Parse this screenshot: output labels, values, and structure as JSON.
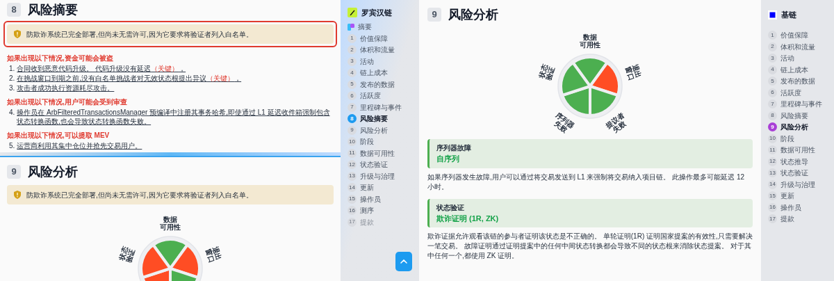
{
  "left_panel": {
    "sections": [
      {
        "number": "8",
        "title": "风险摘要",
        "alert": {
          "text": "防欺诈系统已完全部署,但尚未无需许可,因为它要求将验证者列入白名单。",
          "highlighted": true
        },
        "risk_groups": [
          {
            "heading": "如果出现以下情况,资金可能会被盗",
            "items": [
              {
                "number": "1.",
                "text": "合同收到恶意代码升级。 代码升级没有延迟",
                "tag": "（关键）",
                "end": "，"
              },
              {
                "number": "2.",
                "text": "在挑战窗口到期之前,没有白名单挑战者对无效状态根提出异议",
                "tag": "（关键）",
                "end": "，"
              },
              {
                "number": "3.",
                "text": "攻击者成功执行资源耗尽攻击。"
              }
            ]
          },
          {
            "heading": "如果出现以下情况,用户可能会受到审查",
            "items": [
              {
                "number": "4.",
                "text": "操作员在 ArbFilteredTransactionsManager 预编译中注册其事务哈希,即使通过 L1 延迟收件箱强制包含状态转换函数,也会导致状态转换函数失败。"
              }
            ]
          },
          {
            "heading": "如果出现以下情况,可以提取 MEV",
            "items": [
              {
                "number": "5.",
                "text": "运营商利用其集中仓位并抢先交易用户。"
              }
            ]
          }
        ]
      },
      {
        "number": "9",
        "title": "风险分析",
        "alert": {
          "text": "防欺诈系统已完全部署,但尚未无需许可,因为它要求将验证者列入白名单。",
          "highlighted": false
        },
        "rosette": {
          "slices": [
            {
              "label_lines": [
                "数据",
                "可用性"
              ],
              "color": "#4caf50"
            },
            {
              "label_lines": [
                "退出",
                "窗口"
              ],
              "color": "#ff4d24"
            },
            {
              "color": "#4caf50"
            },
            {
              "color": "#ff4d24"
            },
            {
              "label_lines": [
                "状态",
                "验证"
              ],
              "color": "#ff4d24"
            }
          ]
        }
      }
    ]
  },
  "sidebar": {
    "title": "罗宾汉链",
    "items": [
      {
        "kind": "overview",
        "label": "摘要",
        "selected": false,
        "faded": false
      },
      {
        "kind": "section",
        "number": "1",
        "label": "价值保障",
        "selected": false,
        "faded": false
      },
      {
        "kind": "section",
        "number": "2",
        "label": "体积和流量",
        "selected": false,
        "faded": false
      },
      {
        "kind": "section",
        "number": "3",
        "label": "活动",
        "selected": false,
        "faded": false
      },
      {
        "kind": "section",
        "number": "4",
        "label": "链上成本",
        "selected": false,
        "faded": false
      },
      {
        "kind": "section",
        "number": "5",
        "label": "发布的数据",
        "selected": false,
        "faded": false
      },
      {
        "kind": "section",
        "number": "6",
        "label": "活跃度",
        "selected": false,
        "faded": false
      },
      {
        "kind": "section",
        "number": "7",
        "label": "里程碑与事件",
        "selected": false,
        "faded": false
      },
      {
        "kind": "section",
        "number": "8",
        "label": "风险摘要",
        "selected": true,
        "faded": false
      },
      {
        "kind": "section",
        "number": "9",
        "label": "风险分析",
        "selected": false,
        "faded": false
      },
      {
        "kind": "section",
        "number": "10",
        "label": "阶段",
        "selected": false,
        "faded": false
      },
      {
        "kind": "section",
        "number": "11",
        "label": "数据可用性",
        "selected": false,
        "faded": false
      },
      {
        "kind": "section",
        "number": "12",
        "label": "状态验证",
        "selected": false,
        "faded": false
      },
      {
        "kind": "section",
        "number": "13",
        "label": "升级与治理",
        "selected": false,
        "faded": false
      },
      {
        "kind": "section",
        "number": "14",
        "label": "更新",
        "selected": false,
        "faded": false
      },
      {
        "kind": "section",
        "number": "15",
        "label": "操作员",
        "selected": false,
        "faded": false
      },
      {
        "kind": "section",
        "number": "16",
        "label": "测序",
        "selected": false,
        "faded": false
      },
      {
        "kind": "section",
        "number": "17",
        "label": "提款",
        "selected": false,
        "faded": true
      }
    ]
  },
  "main": {
    "number": "9",
    "title": "风险分析",
    "rosette": {
      "slices": [
        {
          "label_lines": [
            "数据",
            "可用性"
          ],
          "color": "#4caf50"
        },
        {
          "label_lines": [
            "退出",
            "窗口"
          ],
          "color": "#ff4d24"
        },
        {
          "label_lines": [
            "提议者",
            "失败"
          ],
          "color": "#4caf50"
        },
        {
          "label_lines": [
            "序列器",
            "失败"
          ],
          "color": "#4caf50"
        },
        {
          "label_lines": [
            "状态",
            "验证"
          ],
          "color": "#4caf50"
        }
      ]
    },
    "details": [
      {
        "caption": "序列器故障",
        "value": "自序列",
        "description": "如果序列器发生故障,用户可以通过将交易发送到 L1 来强制将交易纳入项目链。 此操作最多可能延迟 12 小时。"
      },
      {
        "caption": "状态验证",
        "value": "欺诈证明 (1R, ZK)",
        "description": "欺诈证据允许观看该链的参与者证明该状态是不正确的。 单轮证明(1R) 证明国家提案的有效性,只需要解决一笔交易。 故障证明通过证明提案中的任何中间状态转换都会导致不同的状态根来消除状态提案。 对于其中任何一个,都使用 ZK 证明。"
      }
    ]
  },
  "right_sidebar": {
    "title": "基链",
    "items": [
      {
        "kind": "section",
        "number": "1",
        "label": "价值保障",
        "selected": false,
        "faded": false
      },
      {
        "kind": "section",
        "number": "2",
        "label": "体积和流量",
        "selected": false,
        "faded": false
      },
      {
        "kind": "section",
        "number": "3",
        "label": "活动",
        "selected": false,
        "faded": false
      },
      {
        "kind": "section",
        "number": "4",
        "label": "链上成本",
        "selected": false,
        "faded": false
      },
      {
        "kind": "section",
        "number": "5",
        "label": "发布的数据",
        "selected": false,
        "faded": false
      },
      {
        "kind": "section",
        "number": "6",
        "label": "活跃度",
        "selected": false,
        "faded": false
      },
      {
        "kind": "section",
        "number": "7",
        "label": "里程碑与事件",
        "selected": false,
        "faded": false
      },
      {
        "kind": "section",
        "number": "8",
        "label": "风险摘要",
        "selected": false,
        "faded": false
      },
      {
        "kind": "section",
        "number": "9",
        "label": "风险分析",
        "selected": true,
        "faded": false
      },
      {
        "kind": "section",
        "number": "10",
        "label": "阶段",
        "selected": false,
        "faded": false
      },
      {
        "kind": "section",
        "number": "11",
        "label": "数据可用性",
        "selected": false,
        "faded": false
      },
      {
        "kind": "section",
        "number": "12",
        "label": "状态推导",
        "selected": false,
        "faded": false
      },
      {
        "kind": "section",
        "number": "13",
        "label": "状态验证",
        "selected": false,
        "faded": false
      },
      {
        "kind": "section",
        "number": "14",
        "label": "升级与治理",
        "selected": false,
        "faded": false
      },
      {
        "kind": "section",
        "number": "15",
        "label": "更新",
        "selected": false,
        "faded": false
      },
      {
        "kind": "section",
        "number": "16",
        "label": "操作员",
        "selected": false,
        "faded": false
      },
      {
        "kind": "section",
        "number": "17",
        "label": "提款",
        "selected": false,
        "faded": false
      }
    ]
  }
}
